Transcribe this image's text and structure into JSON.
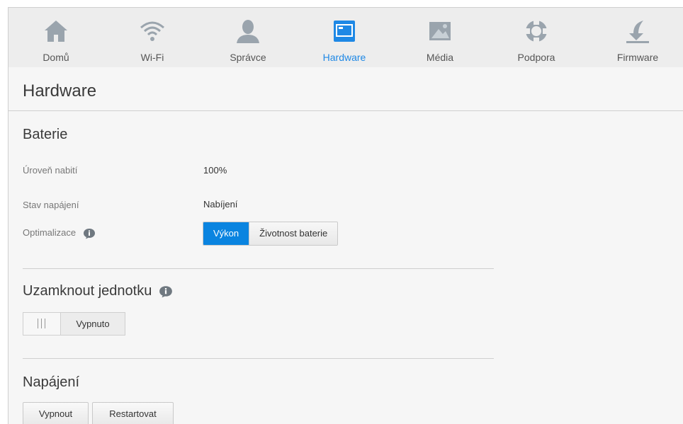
{
  "nav": {
    "items": [
      {
        "label": "Domů",
        "icon": "home-icon"
      },
      {
        "label": "Wi-Fi",
        "icon": "wifi-icon"
      },
      {
        "label": "Správce",
        "icon": "user-icon"
      },
      {
        "label": "Hardware",
        "icon": "hardware-icon"
      },
      {
        "label": "Média",
        "icon": "media-icon"
      },
      {
        "label": "Podpora",
        "icon": "support-icon"
      },
      {
        "label": "Firmware",
        "icon": "firmware-icon"
      }
    ],
    "active_label": "Hardware",
    "active_color": "#1e88e5"
  },
  "page": {
    "title": "Hardware"
  },
  "battery": {
    "title": "Baterie",
    "charge_label": "Úroveň nabití",
    "charge_value": "100%",
    "power_label": "Stav napájení",
    "power_value": "Nabíjení",
    "optim_label": "Optimalizace",
    "optim_options": [
      "Výkon",
      "Životnost baterie"
    ],
    "optim_selected": "Výkon"
  },
  "lock": {
    "title": "Uzamknout jednotku",
    "toggle_state": "Vypnuto"
  },
  "power": {
    "title": "Napájení",
    "off_label": "Vypnout",
    "restart_label": "Restartovat"
  },
  "colors": {
    "accent": "#0a84e0",
    "icon_gray": "#9aa4ad"
  }
}
